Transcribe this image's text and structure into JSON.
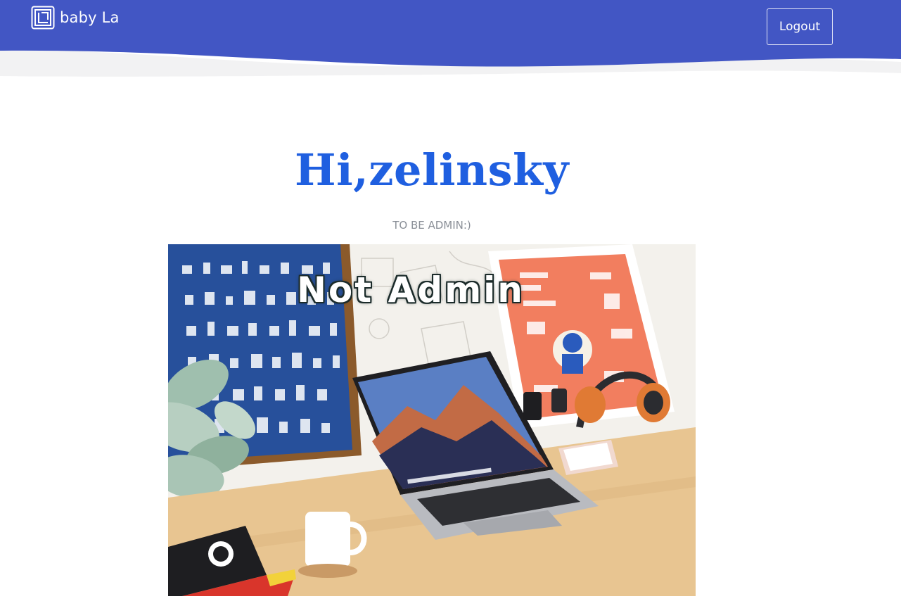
{
  "header": {
    "brand_name": "baby La",
    "logout_label": "Logout",
    "background_color": "#4256c4"
  },
  "main": {
    "greeting": "Hi,zelinsky",
    "subtitle": "TO BE ADMIN:)",
    "greeting_color": "#1f5fe0",
    "hero": {
      "caption": "Not Admin",
      "scene": "desk-laptop-photo"
    }
  }
}
